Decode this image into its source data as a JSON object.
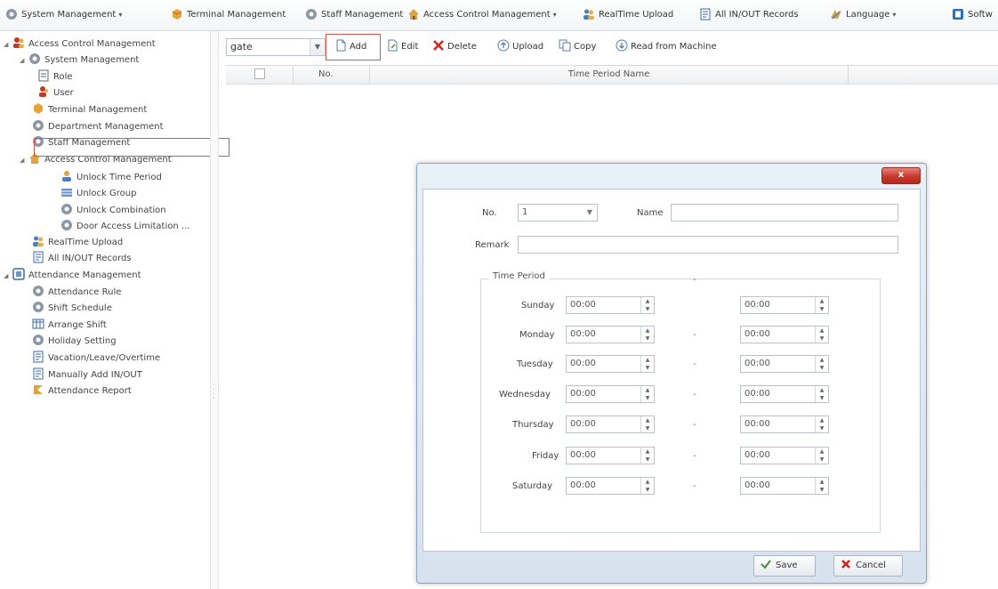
{
  "menubar": {
    "items": [
      {
        "label": "System Management",
        "icon": "gear-icon",
        "dropdown": true
      },
      {
        "label": "Terminal Management",
        "icon": "terminal-icon",
        "dropdown": false
      },
      {
        "label": "Staff Management",
        "icon": "gear-icon",
        "dropdown": false
      },
      {
        "label": "Access Control Management",
        "icon": "house-icon",
        "dropdown": true
      },
      {
        "label": "RealTime Upload",
        "icon": "people-icon",
        "dropdown": false
      },
      {
        "label": "All IN/OUT Records",
        "icon": "record-icon",
        "dropdown": false
      },
      {
        "label": "Language",
        "icon": "language-icon",
        "dropdown": true
      },
      {
        "label": "Softw",
        "icon": "office-icon",
        "dropdown": false
      }
    ]
  },
  "sidebar": {
    "items": [
      {
        "label": "Access Control Management",
        "icon": "users-icon",
        "toggle": "expanded"
      },
      {
        "label": "System Management",
        "icon": "gear-icon",
        "toggle": "expanded"
      },
      {
        "label": "Role",
        "icon": "document-icon",
        "toggle": ""
      },
      {
        "label": "User",
        "icon": "user-icon",
        "toggle": ""
      },
      {
        "label": "Terminal Management",
        "icon": "terminal-icon",
        "toggle": ""
      },
      {
        "label": "Department Management",
        "icon": "gear-icon",
        "toggle": ""
      },
      {
        "label": "Staff Management",
        "icon": "gear-icon",
        "toggle": ""
      },
      {
        "label": "Access Control Management",
        "icon": "house-icon",
        "toggle": "expanded"
      },
      {
        "label": "Unlock Time Period",
        "icon": "user-icon",
        "toggle": ""
      },
      {
        "label": "Unlock Group",
        "icon": "grid-icon",
        "toggle": ""
      },
      {
        "label": "Unlock Combination",
        "icon": "gear-icon",
        "toggle": ""
      },
      {
        "label": "Door Access Limitation ...",
        "icon": "gear-icon",
        "toggle": ""
      },
      {
        "label": "RealTime Upload",
        "icon": "people-icon",
        "toggle": ""
      },
      {
        "label": "All IN/OUT Records",
        "icon": "record-icon",
        "toggle": ""
      },
      {
        "label": "Attendance Management",
        "icon": "calendar-icon",
        "toggle": "expanded"
      },
      {
        "label": "Attendance Rule",
        "icon": "gear-icon",
        "toggle": ""
      },
      {
        "label": "Shift Schedule",
        "icon": "gear-icon",
        "toggle": ""
      },
      {
        "label": "Arrange Shift",
        "icon": "table-icon",
        "toggle": ""
      },
      {
        "label": "Holiday Setting",
        "icon": "gear-icon",
        "toggle": ""
      },
      {
        "label": "Vacation/Leave/Overtime",
        "icon": "record-icon",
        "toggle": ""
      },
      {
        "label": "Manually Add IN/OUT",
        "icon": "record-icon",
        "toggle": ""
      },
      {
        "label": "Attendance Report",
        "icon": "report-icon",
        "toggle": ""
      }
    ]
  },
  "toolbar": {
    "gate_value": "gate",
    "add_label": "Add",
    "edit_label": "Edit",
    "delete_label": "Delete",
    "upload_label": "Upload",
    "copy_label": "Copy",
    "read_label": "Read from Machine"
  },
  "grid": {
    "columns": [
      "No.",
      "Time Period Name"
    ]
  },
  "dialog": {
    "close_label": "x",
    "no_label": "No.",
    "no_value": "1",
    "name_label": "Name",
    "name_value": "",
    "remark_label": "Remark",
    "remark_value": "",
    "time_period_label": "Time Period",
    "separator": "-",
    "days": [
      {
        "day": "Sunday",
        "start": "00:00",
        "end": "00:00"
      },
      {
        "day": "Monday",
        "start": "00:00",
        "end": "00:00"
      },
      {
        "day": "Tuesday",
        "start": "00:00",
        "end": "00:00"
      },
      {
        "day": "Wednesday",
        "start": "00:00",
        "end": "00:00"
      },
      {
        "day": "Thursday",
        "start": "00:00",
        "end": "00:00"
      },
      {
        "day": "Friday",
        "start": "00:00",
        "end": "00:00"
      },
      {
        "day": "Saturday",
        "start": "00:00",
        "end": "00:00"
      }
    ],
    "save_label": "Save",
    "cancel_label": "Cancel"
  },
  "colors": {
    "highlight": "#d9534f",
    "close_button": "#c6382b",
    "dialog_frame": "#d6e2ee"
  }
}
